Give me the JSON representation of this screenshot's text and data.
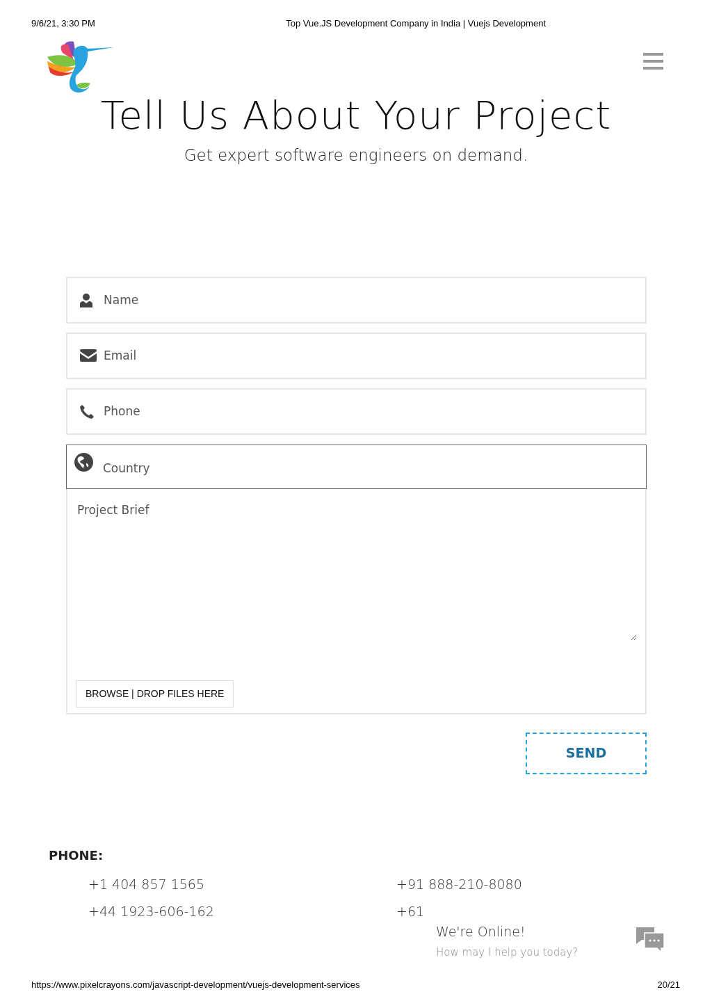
{
  "print_header": {
    "date": "9/6/21, 3:30 PM",
    "title": "Top Vue.JS Development Company in India | Vuejs Development"
  },
  "hero": {
    "title": "Tell Us About Your Project",
    "subtitle": "Get expert software engineers on demand."
  },
  "form": {
    "fields": [
      {
        "kind": "text",
        "placeholder": "Name",
        "focused": false
      },
      {
        "kind": "email",
        "placeholder": "Email",
        "focused": false
      },
      {
        "kind": "tel",
        "placeholder": "Phone",
        "focused": false
      },
      {
        "kind": "country",
        "placeholder": "Country",
        "focused": true
      }
    ],
    "brief": {
      "placeholder": "Project Brief",
      "upload_button": "BROWSE | DROP FILES HERE"
    },
    "submit": "SEND"
  },
  "contact": {
    "heading": "PHONE:",
    "phones": [
      "+1 404 857 1565",
      "+91 888-210-8080",
      "+44 1923-606-162",
      "+61"
    ]
  },
  "chat": {
    "title": "We're Online!",
    "subtitle": "How may I help you today?"
  },
  "print_footer": {
    "url": "https://www.pixelcrayons.com/javascript-development/vuejs-development-services",
    "page": "20/21"
  }
}
